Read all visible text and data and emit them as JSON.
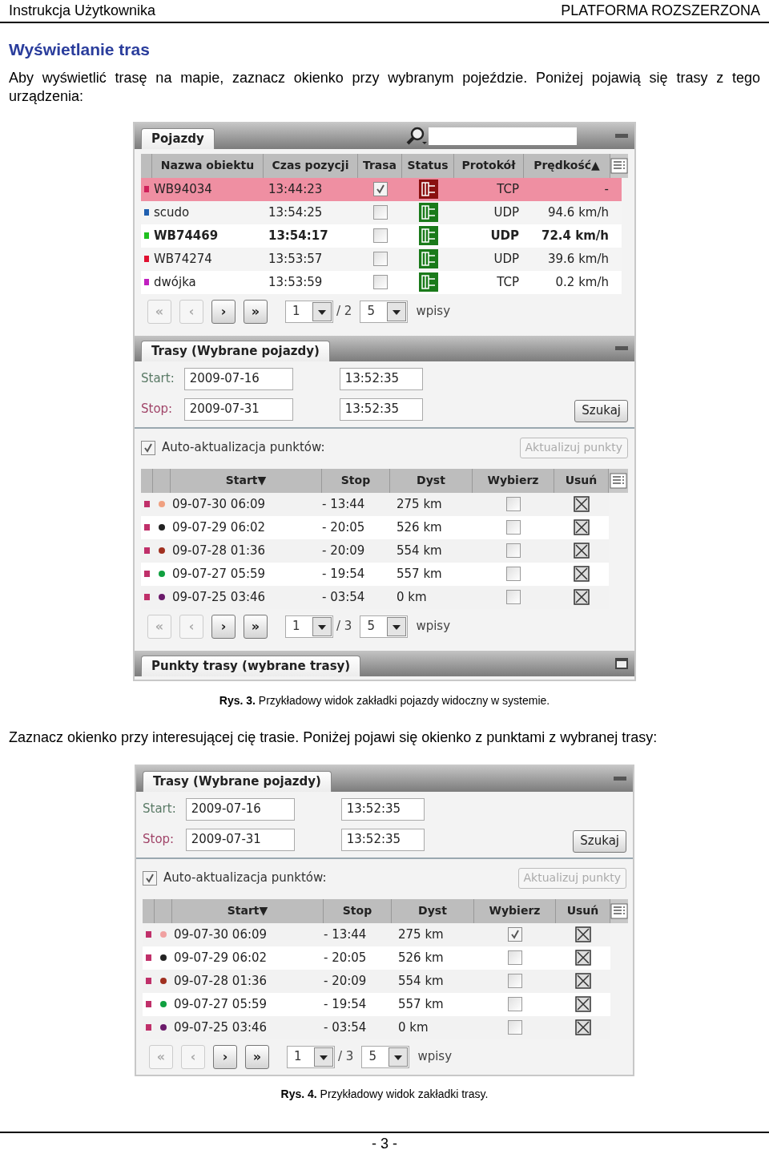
{
  "page_header": {
    "left": "Instrukcja Użytkownika",
    "right": "PLATFORMA ROZSZERZONA"
  },
  "section_title": "Wyświetlanie tras",
  "intro": "Aby wyświetlić trasę na mapie, zaznacz okienko przy wybranym pojeździe. Poniżej pojawią się trasy z tego urządzenia:",
  "figure_1": {
    "vehicles_panel": {
      "tab": "Pojazdy",
      "columns": [
        "Nazwa obiektu",
        "Czas pozycji",
        "Trasa",
        "Status",
        "Protokół",
        "Prędkość▲"
      ],
      "rows": [
        {
          "color": "#d0205a",
          "name": "WB94034",
          "time": "13:44:23",
          "route_checked": true,
          "alert": true,
          "protocol": "TCP",
          "speed": "-",
          "selected": true,
          "bold": false
        },
        {
          "color": "#2060b0",
          "name": "scudo",
          "time": "13:54:25",
          "route_checked": false,
          "alert": false,
          "protocol": "UDP",
          "speed": "94.6 km/h",
          "selected": false,
          "bold": false
        },
        {
          "color": "#20c020",
          "name": "WB74469",
          "time": "13:54:17",
          "route_checked": false,
          "alert": false,
          "protocol": "UDP",
          "speed": "72.4 km/h",
          "selected": false,
          "bold": true
        },
        {
          "color": "#e01030",
          "name": "WB74274",
          "time": "13:53:57",
          "route_checked": false,
          "alert": false,
          "protocol": "UDP",
          "speed": "39.6 km/h",
          "selected": false,
          "bold": false
        },
        {
          "color": "#c020c0",
          "name": "dwójka",
          "time": "13:53:59",
          "route_checked": false,
          "alert": false,
          "protocol": "TCP",
          "speed": "0.2 km/h",
          "selected": false,
          "bold": false
        }
      ],
      "pager": {
        "buttons": [
          {
            "label": "«",
            "disabled": true
          },
          {
            "label": "‹",
            "disabled": true
          },
          {
            "label": "›",
            "disabled": false
          },
          {
            "label": "»",
            "disabled": false
          }
        ],
        "page": "1",
        "pages": "/ 2",
        "per_page": "5",
        "unit": "wpisy"
      }
    },
    "routes_panel": {
      "tab": "Trasy (Wybrane pojazdy)",
      "start_label": "Start:",
      "start_date": "2009-07-16",
      "start_time": "13:52:35",
      "stop_label": "Stop:",
      "stop_date": "2009-07-31",
      "stop_time": "13:52:35",
      "search_button": "Szukaj",
      "auto_update": {
        "label": "Auto-aktualizacja punktów:",
        "checked": true
      },
      "update_button": {
        "label": "Aktualizuj punkty",
        "disabled": true
      },
      "columns": [
        "Start▼",
        "Stop",
        "Dyst",
        "Wybierz",
        "Usuń"
      ],
      "rows": [
        {
          "color": "#f0a080",
          "start": "09-07-30 06:09",
          "stop": "- 13:44",
          "distance": "275 km",
          "selected": false
        },
        {
          "color": "#222222",
          "start": "09-07-29 06:02",
          "stop": "- 20:05",
          "distance": "526 km",
          "selected": false
        },
        {
          "color": "#a03020",
          "start": "09-07-28 01:36",
          "stop": "- 20:09",
          "distance": "554 km",
          "selected": false
        },
        {
          "color": "#10a040",
          "start": "09-07-27 05:59",
          "stop": "- 19:54",
          "distance": "557 km",
          "selected": false
        },
        {
          "color": "#6a1a6a",
          "start": "09-07-25 03:46",
          "stop": "- 03:54",
          "distance": "0 km",
          "selected": false
        }
      ],
      "pager": {
        "buttons": [
          {
            "label": "«",
            "disabled": true
          },
          {
            "label": "‹",
            "disabled": true
          },
          {
            "label": "›",
            "disabled": false
          },
          {
            "label": "»",
            "disabled": false
          }
        ],
        "page": "1",
        "pages": "/ 3",
        "per_page": "5",
        "unit": "wpisy"
      }
    },
    "points_panel": {
      "tab": "Punkty trasy (wybrane trasy)"
    },
    "caption": "**Rys. 3.** Przykładowy widok zakładki pojazdy widoczny w systemie."
  },
  "middle_text": "Zaznacz okienko przy interesującej cię trasie. Poniżej pojawi się okienko z punktami z wybranej trasy:",
  "figure_2": {
    "routes_panel": {
      "tab": "Trasy (Wybrane pojazdy)",
      "start_label": "Start:",
      "start_date": "2009-07-16",
      "start_time": "13:52:35",
      "stop_label": "Stop:",
      "stop_date": "2009-07-31",
      "stop_time": "13:52:35",
      "search_button": "Szukaj",
      "auto_update": {
        "label": "Auto-aktualizacja punktów:",
        "checked": true
      },
      "update_button": {
        "label": "Aktualizuj punkty",
        "disabled": true
      },
      "columns": [
        "Start▼",
        "Stop",
        "Dyst",
        "Wybierz",
        "Usuń"
      ],
      "rows": [
        {
          "color": "#f0a0a0",
          "start": "09-07-30 06:09",
          "stop": "- 13:44",
          "distance": "275 km",
          "selected": true
        },
        {
          "color": "#222222",
          "start": "09-07-29 06:02",
          "stop": "- 20:05",
          "distance": "526 km",
          "selected": false
        },
        {
          "color": "#a03020",
          "start": "09-07-28 01:36",
          "stop": "- 20:09",
          "distance": "554 km",
          "selected": false
        },
        {
          "color": "#10a040",
          "start": "09-07-27 05:59",
          "stop": "- 19:54",
          "distance": "557 km",
          "selected": false
        },
        {
          "color": "#6a1a6a",
          "start": "09-07-25 03:46",
          "stop": "- 03:54",
          "distance": "0 km",
          "selected": false
        }
      ],
      "pager": {
        "buttons": [
          {
            "label": "«",
            "disabled": true
          },
          {
            "label": "‹",
            "disabled": true
          },
          {
            "label": "›",
            "disabled": false
          },
          {
            "label": "»",
            "disabled": false
          }
        ],
        "page": "1",
        "pages": "/ 3",
        "per_page": "5",
        "unit": "wpisy"
      }
    },
    "caption": "**Rys. 4.** Przykładowy widok zakładki trasy."
  },
  "page_number": "- 3 -"
}
